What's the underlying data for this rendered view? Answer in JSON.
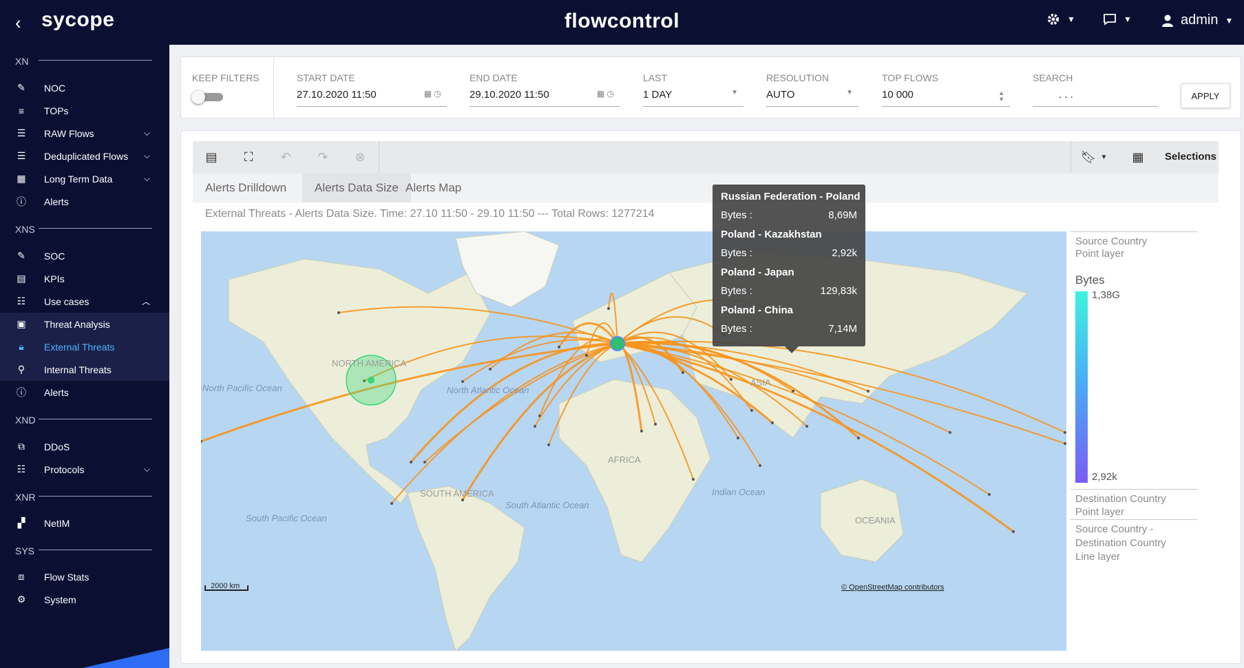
{
  "topbar": {
    "back": "‹",
    "logo": "sycope",
    "title": "flowcontrol",
    "user": "admin"
  },
  "sidebar": {
    "sections": [
      "XN",
      "XNS",
      "XND",
      "XNR",
      "SYS"
    ],
    "items": [
      {
        "label": "NOC",
        "icon": "noc-icon"
      },
      {
        "label": "TOPs",
        "icon": "tops-icon"
      },
      {
        "label": "RAW Flows",
        "icon": "raw-flows-icon"
      },
      {
        "label": "Deduplicated Flows",
        "icon": "deduplicated-flows-icon"
      },
      {
        "label": "Long Term Data",
        "icon": "calendar-icon"
      },
      {
        "label": "Alerts",
        "icon": "alert-icon"
      },
      {
        "label": "SOC",
        "icon": "soc-icon"
      },
      {
        "label": "KPIs",
        "icon": "kpis-icon"
      },
      {
        "label": "Use cases",
        "icon": "list-icon"
      },
      {
        "label": "Threat Analysis",
        "icon": "monitor-icon"
      },
      {
        "label": "External Threats",
        "icon": "lock-icon"
      },
      {
        "label": "Internal Threats",
        "icon": "search-icon"
      },
      {
        "label": "Alerts",
        "icon": "alert-icon"
      },
      {
        "label": "DDoS",
        "icon": "ddos-icon"
      },
      {
        "label": "Protocols",
        "icon": "list-icon"
      },
      {
        "label": "NetIM",
        "icon": "grid-icon"
      },
      {
        "label": "Flow Stats",
        "icon": "chart-icon"
      },
      {
        "label": "System",
        "icon": "gear-icon"
      }
    ]
  },
  "filters": {
    "keep_filters_label": "KEEP FILTERS",
    "start_date_label": "START DATE",
    "start_date": "27.10.2020  11:50",
    "end_date_label": "END DATE",
    "end_date": "29.10.2020  11:50",
    "last_label": "LAST",
    "last": "1 DAY",
    "resolution_label": "RESOLUTION",
    "resolution": "AUTO",
    "top_flows_label": "TOP FLOWS",
    "top_flows": "10 000",
    "search_label": "SEARCH",
    "search_value": ".       .       .",
    "apply": "APPLY"
  },
  "panel": {
    "selections": "Selections",
    "tabs": [
      "Alerts Drilldown",
      "Alerts Data Size",
      "Alerts Map"
    ],
    "active_tab": 1,
    "subtitle": "External Threats - Alerts Data Size. Time: 27.10 11:50 - 29.10 11:50 --- Total Rows: 1277214"
  },
  "map": {
    "labels": {
      "north_america": "NORTH AMERICA",
      "south_america": "SOUTH AMERICA",
      "africa": "AFRICA",
      "asia": "ASIA",
      "oceania": "OCEANIA",
      "north_pacific": "North Pacific Ocean",
      "north_atlantic": "North Atlantic Ocean",
      "south_atlantic": "South Atlantic Ocean",
      "south_pacific": "South Pacific Ocean",
      "indian": "Indian Ocean"
    },
    "scale": "2000 km",
    "attribution": "© OpenStreetMap contributors",
    "colors": {
      "ocean": "#b7d6f2",
      "land": "#eceed9",
      "flow": "#f7941d",
      "point": "#37d67a"
    }
  },
  "legend": {
    "source_point_layer": [
      "Source Country",
      "Point layer"
    ],
    "bytes": "Bytes",
    "max": "1,38G",
    "min": "2,92k",
    "destination_point_layer": [
      "Destination Country",
      "Point layer"
    ],
    "line_layer": [
      "Source Country -",
      "Destination Country",
      "Line layer"
    ]
  },
  "tooltip": {
    "entries": [
      {
        "pair": "Russian Federation - Poland",
        "bytes_label": "Bytes :",
        "bytes": "8,69M"
      },
      {
        "pair": "Poland - Kazakhstan",
        "bytes_label": "Bytes :",
        "bytes": "2,92k"
      },
      {
        "pair": "Poland - Japan",
        "bytes_label": "Bytes :",
        "bytes": "129,83k"
      },
      {
        "pair": "Poland - China",
        "bytes_label": "Bytes :",
        "bytes": "7,14M"
      }
    ]
  }
}
